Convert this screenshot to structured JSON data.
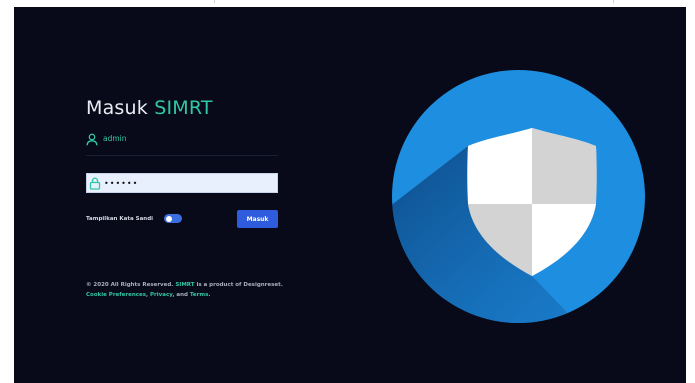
{
  "login": {
    "title_prefix": "Masuk",
    "title_brand": "SIMRT",
    "username_value": "admin",
    "password_value": "••••••",
    "show_password_label": "Tampilkan Kata Sandi",
    "show_password_on": true,
    "submit_label": "Masuk"
  },
  "footer": {
    "copyright_a": "© 2020 All Rights Reserved.",
    "brand_link": "SIMRT",
    "copyright_b": "is a product of",
    "company": "Designreset.",
    "cookie_link": "Cookie Preferences",
    "sep1": ",",
    "privacy_link": "Privacy",
    "and_text": ", and",
    "terms_link": "Terms",
    "end": "."
  },
  "colors": {
    "panel_bg": "#080a19",
    "accent": "#31c7a6",
    "button": "#2f5bdd",
    "circle": "#1e8ee0",
    "input_bg": "#e8f0fe"
  },
  "icons": {
    "user": "user-icon",
    "lock": "lock-icon",
    "shield": "shield-icon"
  }
}
